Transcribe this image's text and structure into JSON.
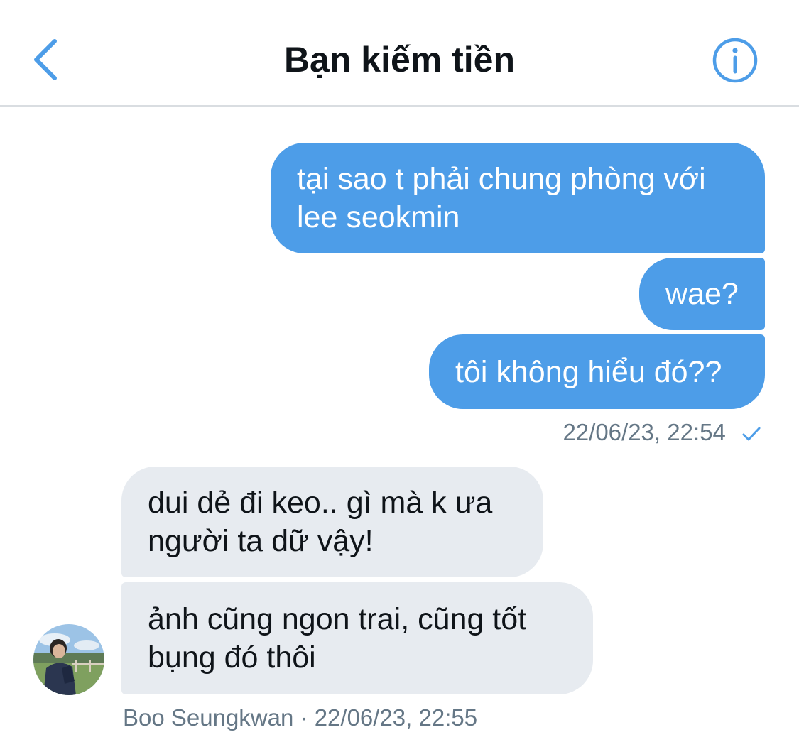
{
  "header": {
    "title": "Bạn kiếm tiền",
    "back_icon": "chevron-left-icon",
    "info_icon": "info-icon",
    "accent_color": "#4d9de8"
  },
  "messages": [
    {
      "direction": "sent",
      "lines": [
        "tại sao t phải chung phòng với",
        "lee seokmin"
      ]
    },
    {
      "direction": "sent",
      "lines": [
        "wae?"
      ]
    },
    {
      "direction": "sent",
      "lines": [
        "tôi không hiểu đó??"
      ]
    },
    {
      "direction": "received",
      "lines": [
        "dui dẻ đi keo.. gì mà k ưa",
        "người ta dữ vậy!"
      ]
    },
    {
      "direction": "received",
      "lines": [
        "ảnh cũng ngon trai, cũng tốt",
        "bụng đó thôi"
      ]
    }
  ],
  "sent_meta": {
    "timestamp": "22/06/23, 22:54",
    "status_icon": "checkmark-icon"
  },
  "received_meta": {
    "sender": "Boo Seungkwan",
    "separator": "·",
    "timestamp": "22/06/23, 22:55"
  },
  "colors": {
    "sent_bubble": "#4d9de8",
    "received_bubble": "#e7ebf0",
    "meta_text": "#657786"
  }
}
